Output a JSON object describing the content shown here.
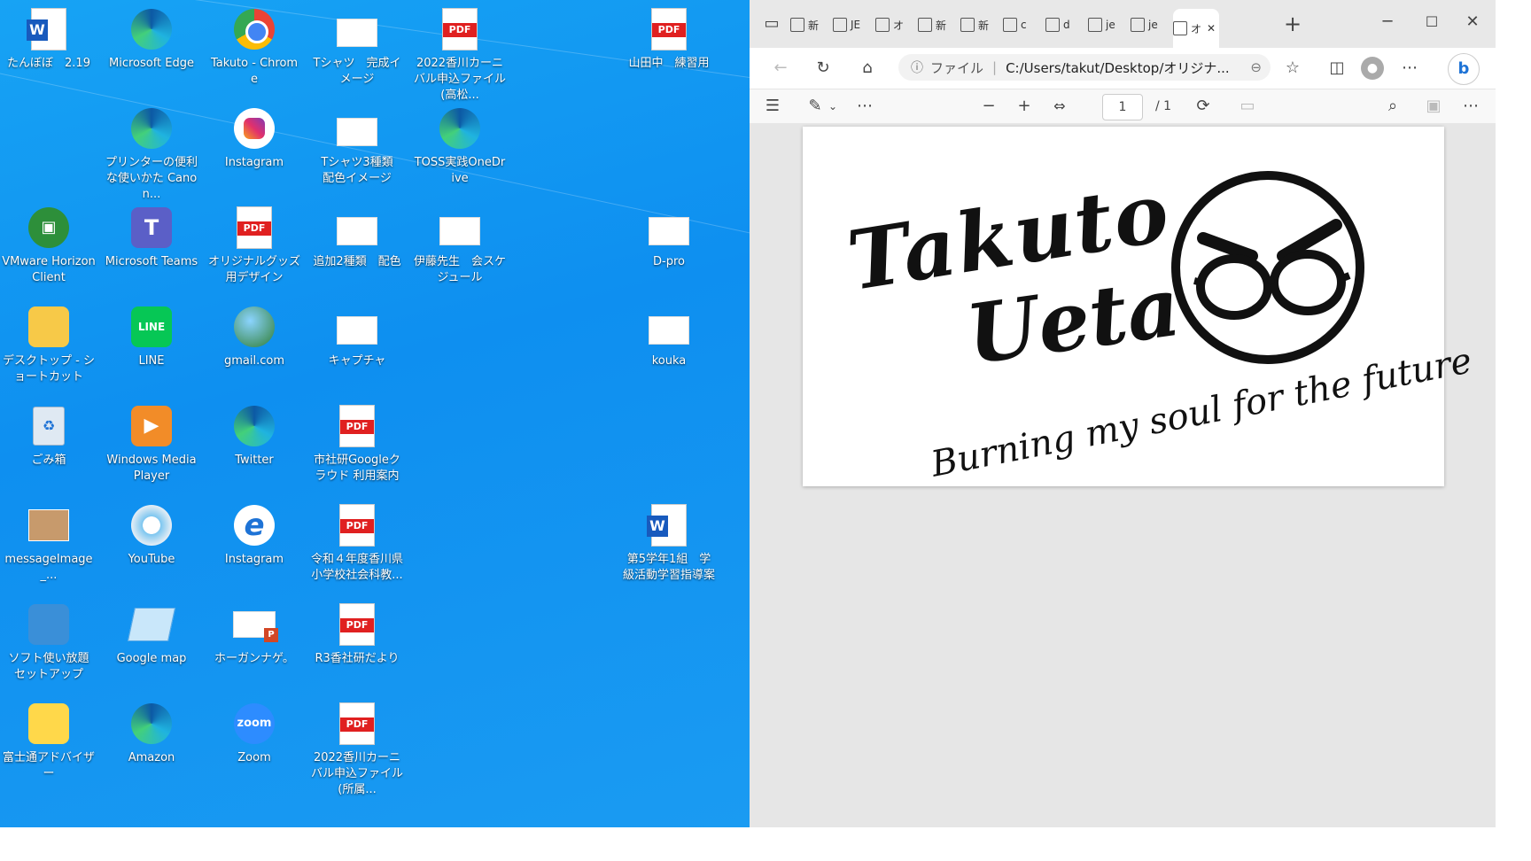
{
  "desktop": {
    "icons": [
      {
        "label": "たんぼぼ　2.19",
        "type": "word"
      },
      {
        "label": "Microsoft Edge",
        "type": "edge"
      },
      {
        "label": "Takuto - Chrome",
        "type": "chrome"
      },
      {
        "label": "Tシャツ　完成イメージ",
        "type": "thumb"
      },
      {
        "label": "2022香川カーニバル申込ファイル(高松...",
        "type": "pdf"
      },
      {
        "label": "山田中　練習用",
        "type": "pdf"
      },
      {
        "label": "プリンターの便利な使いかた Canon...",
        "type": "edge"
      },
      {
        "label": "Instagram",
        "type": "instagram"
      },
      {
        "label": "Tシャツ3種類　配色イメージ",
        "type": "thumb"
      },
      {
        "label": "TOSS実践OneDrive",
        "type": "edge"
      },
      {
        "label": "VMware Horizon Client",
        "type": "vmware"
      },
      {
        "label": "Microsoft Teams",
        "type": "teams"
      },
      {
        "label": "オリジナルグッズ用デザイン",
        "type": "pdf"
      },
      {
        "label": "追加2種類　配色",
        "type": "thumb"
      },
      {
        "label": "伊藤先生　会スケジュール",
        "type": "thumb"
      },
      {
        "label": "D-pro",
        "type": "thumb"
      },
      {
        "label": "デスクトップ - ショートカット",
        "type": "folder"
      },
      {
        "label": "LINE",
        "type": "line"
      },
      {
        "label": "gmail.com",
        "type": "gmail"
      },
      {
        "label": "キャプチャ",
        "type": "thumb"
      },
      {
        "label": "kouka",
        "type": "thumb"
      },
      {
        "label": "ごみ箱",
        "type": "bin"
      },
      {
        "label": "Windows Media Player",
        "type": "wmp"
      },
      {
        "label": "Twitter",
        "type": "edge"
      },
      {
        "label": "市社研Googleクラウド 利用案内",
        "type": "pdf"
      },
      {
        "label": "messageImage_...",
        "type": "photo"
      },
      {
        "label": "YouTube",
        "type": "youtube"
      },
      {
        "label": "Instagram",
        "type": "ie"
      },
      {
        "label": "令和４年度香川県小学校社会科教...",
        "type": "pdf"
      },
      {
        "label": "第5学年1組　学級活動学習指導案",
        "type": "word"
      },
      {
        "label": "ソフト使い放題 セットアップ",
        "type": "setup"
      },
      {
        "label": "Google map",
        "type": "gmap"
      },
      {
        "label": "ホーガンナゲ。",
        "type": "ppt"
      },
      {
        "label": "R3香社研だより",
        "type": "pdf"
      },
      {
        "label": "富士通アドバイザー",
        "type": "advisor"
      },
      {
        "label": "Amazon",
        "type": "edge"
      },
      {
        "label": "Zoom",
        "type": "zoom"
      },
      {
        "label": "2022香川カーニバル申込ファイル(所属...",
        "type": "pdf"
      }
    ]
  },
  "browser": {
    "tabs": [
      "新",
      "JE",
      "オ",
      "新",
      "新",
      "c",
      "d",
      "je",
      "je",
      "オ"
    ],
    "active_tab_label": "オ",
    "address": {
      "scheme_label": "ファイル",
      "url": "C:/Users/takut/Desktop/オリジナ..."
    },
    "pdf": {
      "page_current": "1",
      "page_total": "/ 1",
      "logo": {
        "name_line1": "Takuto",
        "name_line2": "Ueta",
        "tagline": "Burning my soul for the future"
      }
    }
  },
  "colors": {
    "desktop_blue": "#1296f0",
    "pdf_red": "#e02020",
    "edge_accent": "#1fb3e0",
    "bing_blue": "#1e73d6"
  }
}
